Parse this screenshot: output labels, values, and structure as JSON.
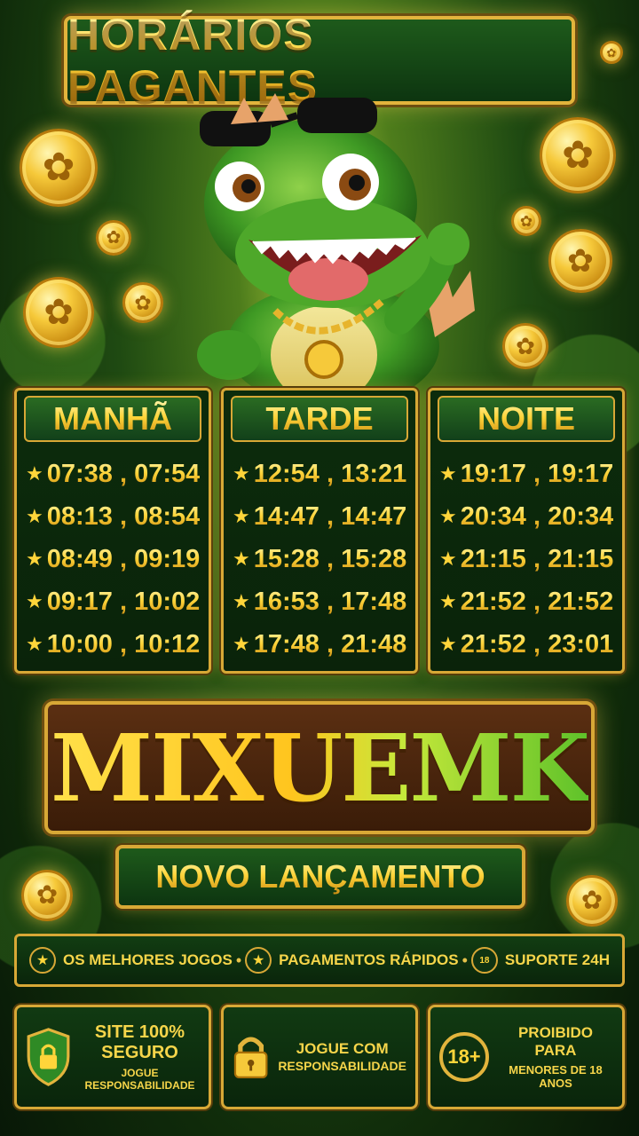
{
  "header": {
    "title": "HORÁRIOS PAGANTES"
  },
  "schedule": [
    {
      "period": "MANHÃ",
      "slots": [
        "07:38 , 07:54",
        "08:13 , 08:54",
        "08:49 , 09:19",
        "09:17 , 10:02",
        "10:00 , 10:12"
      ]
    },
    {
      "period": "TARDE",
      "slots": [
        "12:54 , 13:21",
        "14:47 , 14:47",
        "15:28 , 15:28",
        "16:53 , 17:48",
        "17:48 , 21:48"
      ]
    },
    {
      "period": "NOITE",
      "slots": [
        "19:17 , 19:17",
        "20:34 , 20:34",
        "21:15 , 21:15",
        "21:52 , 21:52",
        "21:52 , 23:01"
      ]
    }
  ],
  "brand": {
    "name": "MIXUEMK",
    "tagline": "NOVO LANÇAMENTO"
  },
  "features": [
    {
      "icon": "star-icon",
      "label": "OS MELHORES JOGOS"
    },
    {
      "icon": "star-icon",
      "label": "PAGAMENTOS RÁPIDOS"
    },
    {
      "icon": "age-18-icon",
      "label": "SUPORTE 24H"
    }
  ],
  "badges": {
    "secure": {
      "line1": "SITE 100%",
      "line2": "SEGURO",
      "line3": "JOGUE RESPONSABILIDADE"
    },
    "responsible": {
      "line1": "JOGUE COM",
      "line2": "RESPONSABILIDADE"
    },
    "age": {
      "icon_text": "18+",
      "line1": "PROIBIDO PARA",
      "line2": "MENORES DE 18 ANOS"
    }
  },
  "colors": {
    "gold": "#f6d54a",
    "green_dark": "#0c2c0c",
    "border_gold": "#d8a836"
  }
}
